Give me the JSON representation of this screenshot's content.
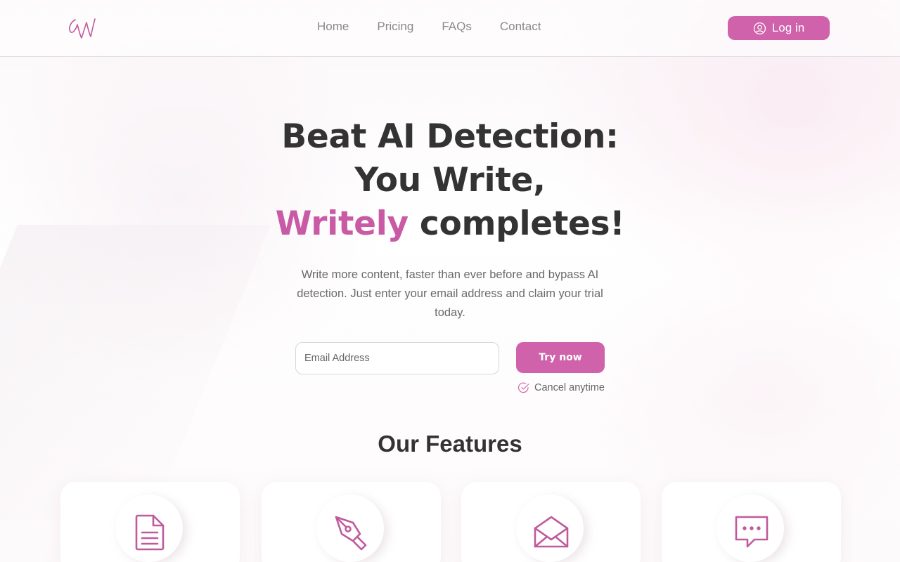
{
  "brand": {
    "logo_letter": "W",
    "accent": "#cf62ab"
  },
  "nav": {
    "items": [
      {
        "label": "Home"
      },
      {
        "label": "Pricing"
      },
      {
        "label": "FAQs"
      },
      {
        "label": "Contact"
      }
    ],
    "login_label": "Log in"
  },
  "hero": {
    "line1": "Beat AI Detection:",
    "line2": "You Write,",
    "accent_word": "Writely",
    "line3_rest": " completes!",
    "subtitle": "Write more content, faster than ever before and bypass AI detection. Just enter your email address and claim your trial today.",
    "email_placeholder": "Email Address",
    "cta_label": "Try now",
    "cancel_note": "Cancel anytime"
  },
  "features": {
    "title": "Our Features",
    "cards": [
      {
        "icon": "document-icon"
      },
      {
        "icon": "pen-nib-icon"
      },
      {
        "icon": "envelope-icon"
      },
      {
        "icon": "chat-bubble-icon"
      }
    ]
  }
}
